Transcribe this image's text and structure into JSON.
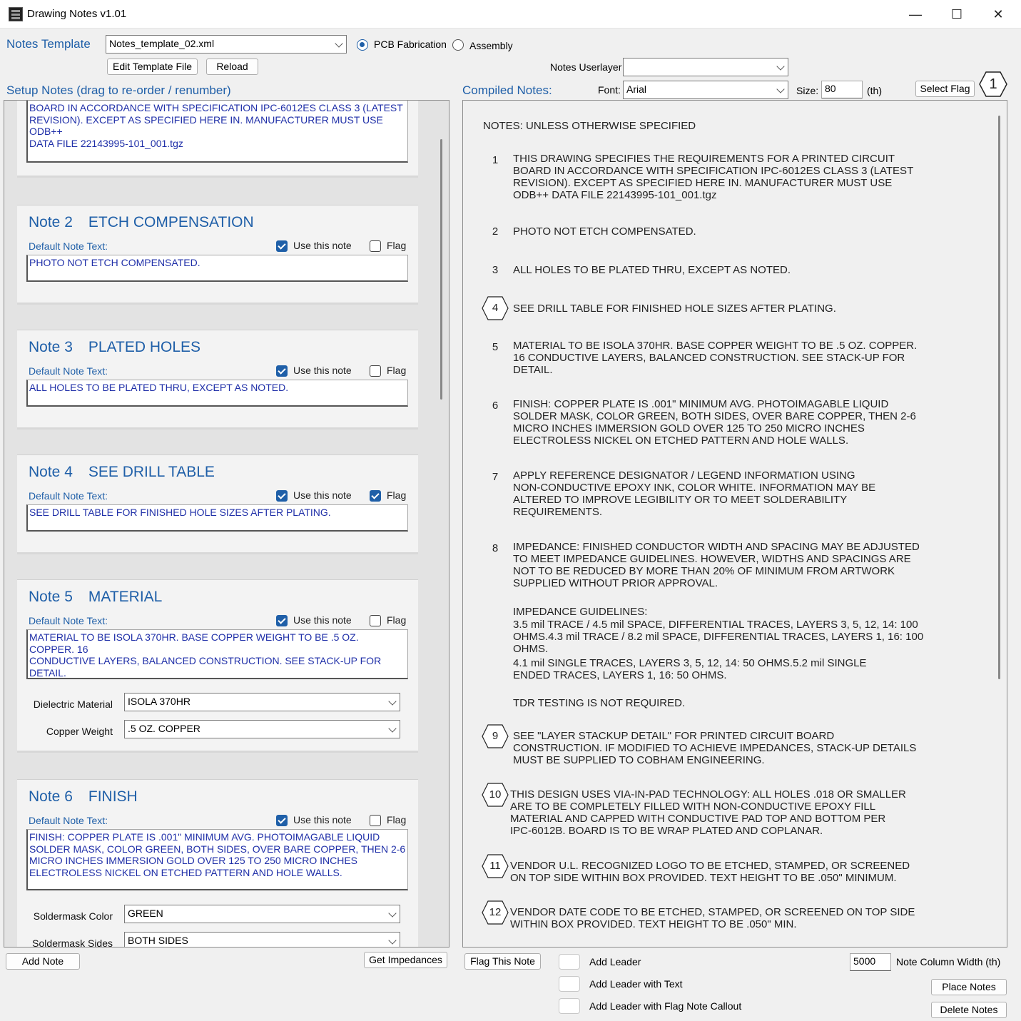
{
  "window": {
    "title": "Drawing Notes v1.01",
    "minimize": "—",
    "maximize": "☐",
    "close": "✕"
  },
  "header": {
    "notes_template_label": "Notes Template",
    "template_value": "Notes_template_02.xml",
    "radio_pcb": "PCB Fabrication",
    "radio_assembly": "Assembly",
    "edit_template_btn": "Edit Template File",
    "reload_btn": "Reload",
    "userlayer_label": "Notes Userlayer",
    "userlayer_value": ""
  },
  "setup_panel": {
    "title": "Setup Notes (drag to re-order / renumber)",
    "note1_text": "BOARD IN ACCORDANCE WITH SPECIFICATION IPC-6012ES CLASS 3 (LATEST\nREVISION). EXCEPT AS SPECIFIED HERE IN. MANUFACTURER MUST USE ODB++\nDATA FILE 22143995-101_001.tgz",
    "default_label": "Default Note Text:",
    "use_label": "Use this note",
    "flag_label": "Flag",
    "notes": [
      {
        "num": "Note 2",
        "title": "ETCH COMPENSATION",
        "text": "PHOTO NOT ETCH COMPENSATED.",
        "use": true,
        "flag": false
      },
      {
        "num": "Note 3",
        "title": "PLATED HOLES",
        "text": "ALL HOLES TO BE PLATED THRU, EXCEPT AS NOTED.",
        "use": true,
        "flag": false
      },
      {
        "num": "Note 4",
        "title": "SEE DRILL TABLE",
        "text": "SEE DRILL TABLE FOR FINISHED HOLE SIZES AFTER PLATING.",
        "use": true,
        "flag": true
      },
      {
        "num": "Note 5",
        "title": "MATERIAL",
        "text": "MATERIAL TO BE ISOLA 370HR. BASE COPPER WEIGHT TO BE .5 OZ. COPPER. 16\nCONDUCTIVE LAYERS, BALANCED CONSTRUCTION. SEE STACK-UP FOR DETAIL.",
        "use": true,
        "flag": false
      },
      {
        "num": "Note 6",
        "title": "FINISH",
        "text": "FINISH: COPPER PLATE IS .001\" MINIMUM AVG. PHOTOIMAGABLE LIQUID\nSOLDER MASK, COLOR GREEN, BOTH SIDES, OVER BARE COPPER, THEN 2-6\nMICRO INCHES IMMERSION GOLD OVER 125 TO 250 MICRO INCHES\nELECTROLESS NICKEL ON ETCHED PATTERN AND HOLE WALLS.",
        "use": true,
        "flag": false
      }
    ],
    "dielectric_label": "Dielectric Material",
    "dielectric_value": "ISOLA 370HR",
    "copper_label": "Copper Weight",
    "copper_value": ".5 OZ. COPPER",
    "soldermask_color_label": "Soldermask Color",
    "soldermask_color_value": "GREEN",
    "soldermask_sides_label": "Soldermask Sides",
    "soldermask_sides_value": "BOTH SIDES",
    "add_note_btn": "Add Note",
    "get_impedances_btn": "Get Impedances"
  },
  "compiled_panel": {
    "title": "Compiled Notes:",
    "font_label": "Font:",
    "font_value": "Arial",
    "size_label": "Size:",
    "size_value": "80",
    "size_unit": "(th)",
    "select_flag_btn": "Select Flag",
    "flag_symbol": "1",
    "heading": "NOTES: UNLESS OTHERWISE SPECIFIED",
    "items": [
      {
        "num": "1",
        "text": "THIS DRAWING SPECIFIES THE REQUIREMENTS FOR A PRINTED CIRCUIT\nBOARD IN ACCORDANCE WITH SPECIFICATION IPC-6012ES CLASS 3 (LATEST\nREVISION). EXCEPT AS SPECIFIED HERE IN. MANUFACTURER MUST USE\nODB++ DATA FILE 22143995-101_001.tgz"
      },
      {
        "num": "2",
        "text": "PHOTO NOT ETCH COMPENSATED."
      },
      {
        "num": "3",
        "text": "ALL HOLES TO BE PLATED THRU, EXCEPT AS NOTED."
      },
      {
        "num": "4",
        "text": "SEE DRILL TABLE FOR FINISHED HOLE SIZES AFTER PLATING."
      },
      {
        "num": "5",
        "text": "MATERIAL TO BE ISOLA 370HR. BASE COPPER WEIGHT TO BE .5 OZ. COPPER.\n16 CONDUCTIVE LAYERS, BALANCED CONSTRUCTION. SEE STACK-UP FOR\nDETAIL."
      },
      {
        "num": "6",
        "text": "FINISH: COPPER PLATE IS .001\" MINIMUM AVG. PHOTOIMAGABLE LIQUID\nSOLDER MASK, COLOR GREEN, BOTH SIDES, OVER BARE COPPER, THEN 2-6\nMICRO INCHES IMMERSION GOLD OVER 125 TO 250 MICRO INCHES\nELECTROLESS NICKEL ON ETCHED PATTERN AND HOLE WALLS."
      },
      {
        "num": "7",
        "text": "APPLY REFERENCE DESIGNATOR / LEGEND INFORMATION USING\nNON-CONDUCTIVE EPOXY INK, COLOR WHITE. INFORMATION MAY BE\nALTERED TO IMPROVE LEGIBILITY OR TO MEET SOLDERABILITY\nREQUIREMENTS."
      },
      {
        "num": "8",
        "text": "IMPEDANCE: FINISHED CONDUCTOR WIDTH AND SPACING MAY BE ADJUSTED\nTO MEET IMPEDANCE GUIDELINES. HOWEVER, WIDTHS AND SPACINGS ARE\nNOT TO BE REDUCED BY MORE THAN 20% OF MINIMUM FROM ARTWORK\nSUPPLIED WITHOUT PRIOR APPROVAL."
      },
      {
        "num": "9",
        "text": "SEE \"LAYER STACKUP DETAIL\" FOR PRINTED CIRCUIT BOARD\nCONSTRUCTION. IF MODIFIED TO ACHIEVE IMPEDANCES, STACK-UP DETAILS\nMUST BE SUPPLIED TO COBHAM ENGINEERING."
      },
      {
        "num": "10",
        "text": "THIS DESIGN USES VIA-IN-PAD TECHNOLOGY: ALL HOLES .018 OR SMALLER\nARE TO BE COMPLETELY FILLED WITH NON-CONDUCTIVE EPOXY FILL\nMATERIAL AND CAPPED WITH CONDUCTIVE PAD TOP AND BOTTOM PER\nIPC-6012B. BOARD IS TO BE WRAP PLATED AND COPLANAR."
      },
      {
        "num": "11",
        "text": "VENDOR U.L. RECOGNIZED LOGO TO BE ETCHED, STAMPED, OR SCREENED\nON TOP SIDE WITHIN BOX PROVIDED. TEXT HEIGHT TO BE .050\" MINIMUM."
      },
      {
        "num": "12",
        "text": "VENDOR DATE CODE TO BE ETCHED, STAMPED, OR SCREENED ON TOP SIDE\nWITHIN BOX PROVIDED. TEXT HEIGHT TO BE .050\" MIN."
      }
    ],
    "impedance_heading": "IMPEDANCE GUIDELINES:",
    "impedance_line1": "3.5 mil TRACE / 4.5 mil SPACE, DIFFERENTIAL TRACES, LAYERS 3, 5, 12, 14: 100\nOHMS.4.3 mil TRACE / 8.2 mil SPACE, DIFFERENTIAL TRACES, LAYERS 1, 16: 100\nOHMS.",
    "impedance_line2": "4.1 mil SINGLE TRACES, LAYERS 3, 5, 12, 14: 50 OHMS.5.2 mil SINGLE\nENDED TRACES, LAYERS 1, 16: 50 OHMS.",
    "tdr_line": "TDR TESTING IS NOT REQUIRED."
  },
  "bottom": {
    "flag_this_note_btn": "Flag This Note",
    "add_leader": "Add Leader",
    "add_leader_text": "Add Leader with Text",
    "add_leader_flag": "Add Leader with Flag Note Callout",
    "width_value": "5000",
    "width_label": "Note Column Width (th)",
    "place_notes_btn": "Place Notes",
    "delete_notes_btn": "Delete Notes"
  },
  "colors": {
    "accent": "#1f5fa8",
    "note_text": "#1f2fa8"
  }
}
